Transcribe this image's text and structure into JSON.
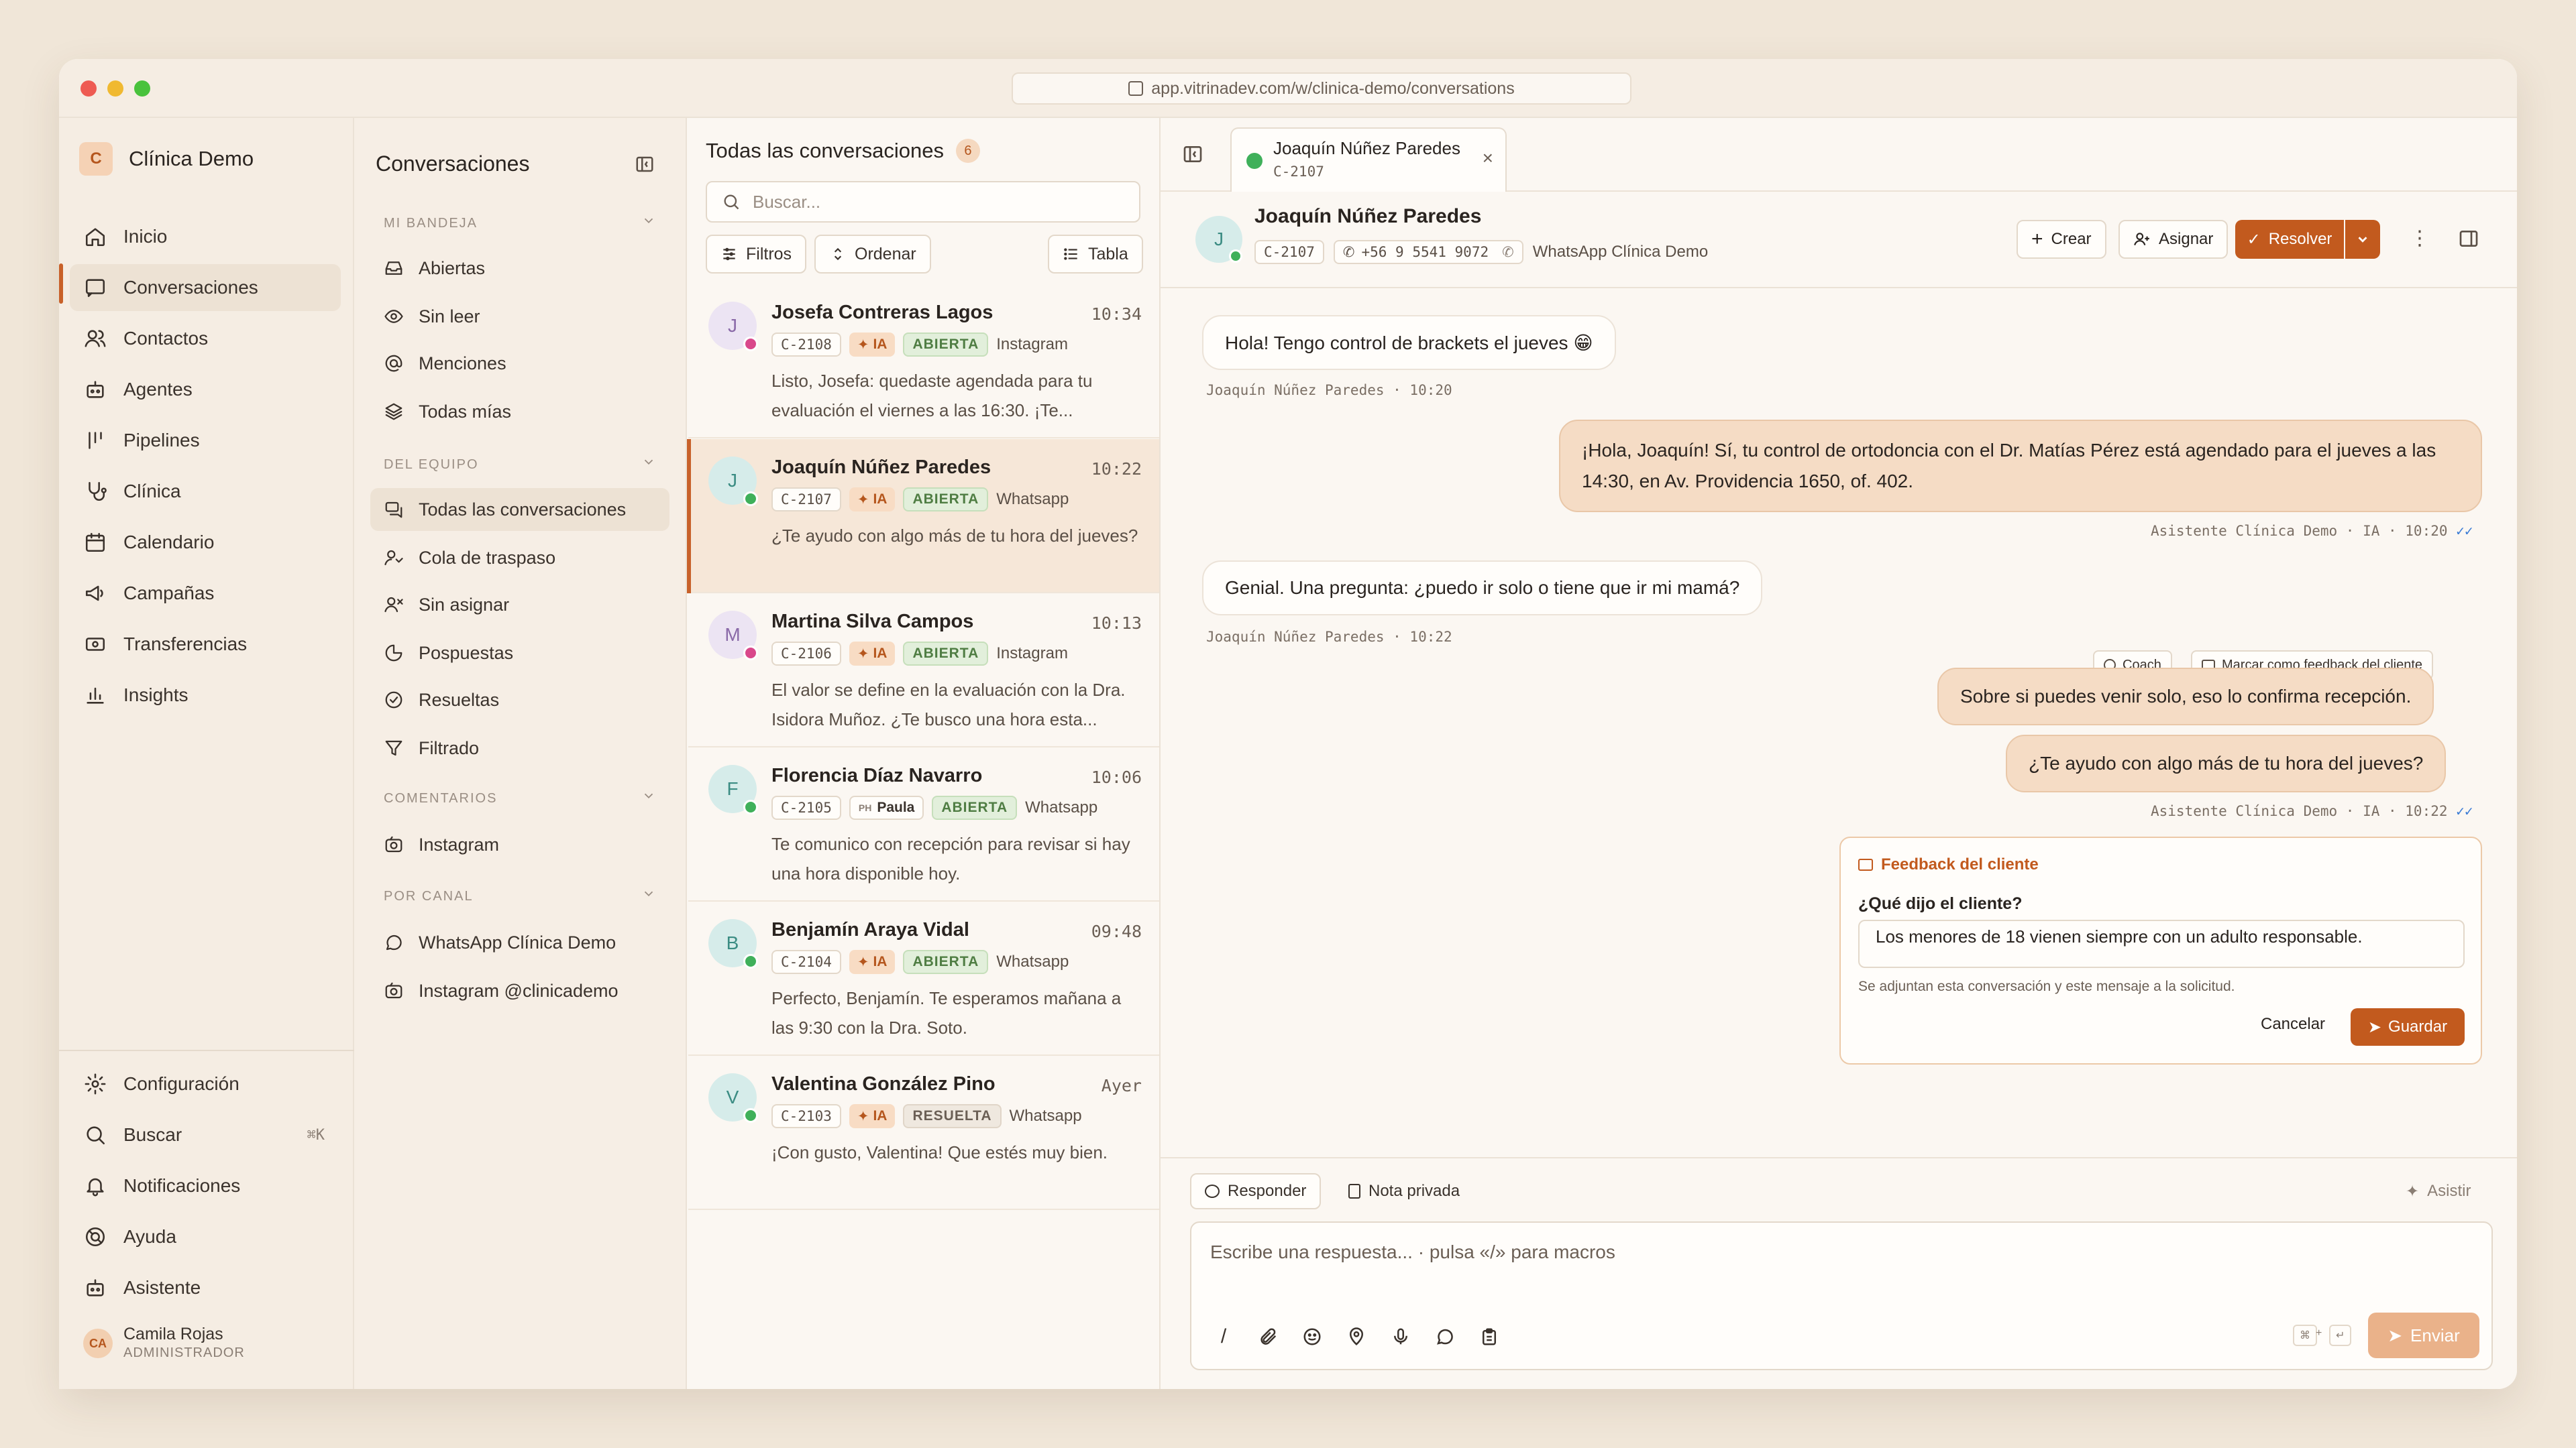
{
  "browser": {
    "url": "app.vitrinadev.com/w/clinica-demo/conversations"
  },
  "brand": {
    "initial": "C",
    "name": "Clínica Demo"
  },
  "nav": {
    "items": [
      {
        "label": "Inicio",
        "icon": "home-icon"
      },
      {
        "label": "Conversaciones",
        "icon": "chat-icon"
      },
      {
        "label": "Contactos",
        "icon": "users-icon"
      },
      {
        "label": "Agentes",
        "icon": "bot-icon"
      },
      {
        "label": "Pipelines",
        "icon": "pipeline-icon"
      },
      {
        "label": "Clínica",
        "icon": "stethoscope-icon"
      },
      {
        "label": "Calendario",
        "icon": "calendar-icon"
      },
      {
        "label": "Campañas",
        "icon": "megaphone-icon"
      },
      {
        "label": "Transferencias",
        "icon": "transfer-icon"
      },
      {
        "label": "Insights",
        "icon": "chart-icon"
      }
    ],
    "bottom": [
      {
        "label": "Configuración",
        "icon": "gear-icon"
      },
      {
        "label": "Buscar",
        "icon": "search-icon",
        "shortcut": "⌘K"
      },
      {
        "label": "Notificaciones",
        "icon": "bell-icon"
      },
      {
        "label": "Ayuda",
        "icon": "help-icon"
      },
      {
        "label": "Asistente",
        "icon": "assistant-icon"
      }
    ]
  },
  "user": {
    "initials": "CA",
    "name": "Camila Rojas",
    "role": "ADMINISTRADOR"
  },
  "inbox": {
    "title": "Conversaciones",
    "sections": [
      {
        "label": "MI BANDEJA",
        "items": [
          "Abiertas",
          "Sin leer",
          "Menciones",
          "Todas mías"
        ]
      },
      {
        "label": "DEL EQUIPO",
        "items": [
          "Todas las conversaciones",
          "Cola de traspaso",
          "Sin asignar",
          "Pospuestas",
          "Resueltas",
          "Filtrado"
        ]
      },
      {
        "label": "COMENTARIOS",
        "items": [
          "Instagram"
        ]
      },
      {
        "label": "POR CANAL",
        "items": [
          "WhatsApp Clínica Demo",
          "Instagram @clinicademo"
        ]
      }
    ]
  },
  "list": {
    "title": "Todas las conversaciones",
    "count": "6",
    "search_placeholder": "Buscar...",
    "filters_label": "Filtros",
    "sort_label": "Ordenar",
    "view_label": "Tabla",
    "conversations": [
      {
        "initial": "J",
        "name": "Josefa Contreras Lagos",
        "time": "10:34",
        "id": "C-2108",
        "ia": "IA",
        "status": "ABIERTA",
        "channel": "Instagram",
        "preview": "Listo, Josefa: quedaste agendada para tu evaluación el viernes a las 16:30. ¡Te..."
      },
      {
        "initial": "J",
        "name": "Joaquín Núñez Paredes",
        "time": "10:22",
        "id": "C-2107",
        "ia": "IA",
        "status": "ABIERTA",
        "channel": "Whatsapp",
        "preview": "¿Te ayudo con algo más de tu hora del jueves?"
      },
      {
        "initial": "M",
        "name": "Martina Silva Campos",
        "time": "10:13",
        "id": "C-2106",
        "ia": "IA",
        "status": "ABIERTA",
        "channel": "Instagram",
        "preview": "El valor se define en la evaluación con la Dra. Isidora Muñoz. ¿Te busco una hora esta..."
      },
      {
        "initial": "F",
        "name": "Florencia Díaz Navarro",
        "time": "10:06",
        "id": "C-2105",
        "agent_initials": "PH",
        "agent": "Paula",
        "status": "ABIERTA",
        "channel": "Whatsapp",
        "preview": "Te comunico con recepción para revisar si hay una hora disponible hoy."
      },
      {
        "initial": "B",
        "name": "Benjamín Araya Vidal",
        "time": "09:48",
        "id": "C-2104",
        "ia": "IA",
        "status": "ABIERTA",
        "channel": "Whatsapp",
        "preview": "Perfecto, Benjamín. Te esperamos mañana a las 9:30 con la Dra. Soto."
      },
      {
        "initial": "V",
        "name": "Valentina González Pino",
        "time": "Ayer",
        "id": "C-2103",
        "ia": "IA",
        "status": "RESUELTA",
        "channel": "Whatsapp",
        "preview": "¡Con gusto, Valentina! Que estés muy bien."
      }
    ]
  },
  "chat": {
    "tab": {
      "name": "Joaquín Núñez Paredes",
      "id": "C-2107"
    },
    "contact": {
      "initial": "J",
      "name": "Joaquín Núñez Paredes",
      "id": "C-2107",
      "phone": "+56 9 5541 9072",
      "inbox": "WhatsApp Clínica Demo"
    },
    "actions": {
      "create": "Crear",
      "assign": "Asignar",
      "resolve": "Resolver"
    },
    "messages": [
      {
        "text": "Hola! Tengo control de brackets el jueves 😁",
        "meta": "Joaquín Núñez Paredes · 10:20"
      },
      {
        "text": "¡Hola, Joaquín! Sí, tu control de ortodoncia con el Dr. Matías Pérez está agendado para el jueves a las 14:30, en Av. Providencia 1650, of. 402.",
        "meta": "Asistente Clínica Demo · IA · 10:20"
      },
      {
        "text": "Genial. Una pregunta: ¿puedo ir solo o tiene que ir mi mamá?",
        "meta": "Joaquín Núñez Paredes · 10:22"
      },
      {
        "text": "Sobre si puedes venir solo, eso lo confirma recepción."
      },
      {
        "text": "¿Te ayudo con algo más de tu hora del jueves?",
        "meta": "Asistente Clínica Demo · IA · 10:22"
      }
    ],
    "coach_label": "Coach",
    "mark_feedback_label": "Marcar como feedback del cliente",
    "feedback": {
      "title": "Feedback del cliente",
      "question": "¿Qué dijo el cliente?",
      "value": "Los menores de 18 vienen siempre con un adulto responsable.",
      "note": "Se adjuntan esta conversación y este mensaje a la solicitud.",
      "cancel": "Cancelar",
      "save": "Guardar"
    },
    "composer": {
      "reply_tab": "Responder",
      "private_tab": "Nota privada",
      "assist": "Asistir",
      "placeholder": "Escribe una respuesta...  ·  pulsa «/» para macros",
      "send": "Enviar",
      "kbd1": "⌘",
      "kbd_plus": "+",
      "kbd2": "↵"
    }
  }
}
